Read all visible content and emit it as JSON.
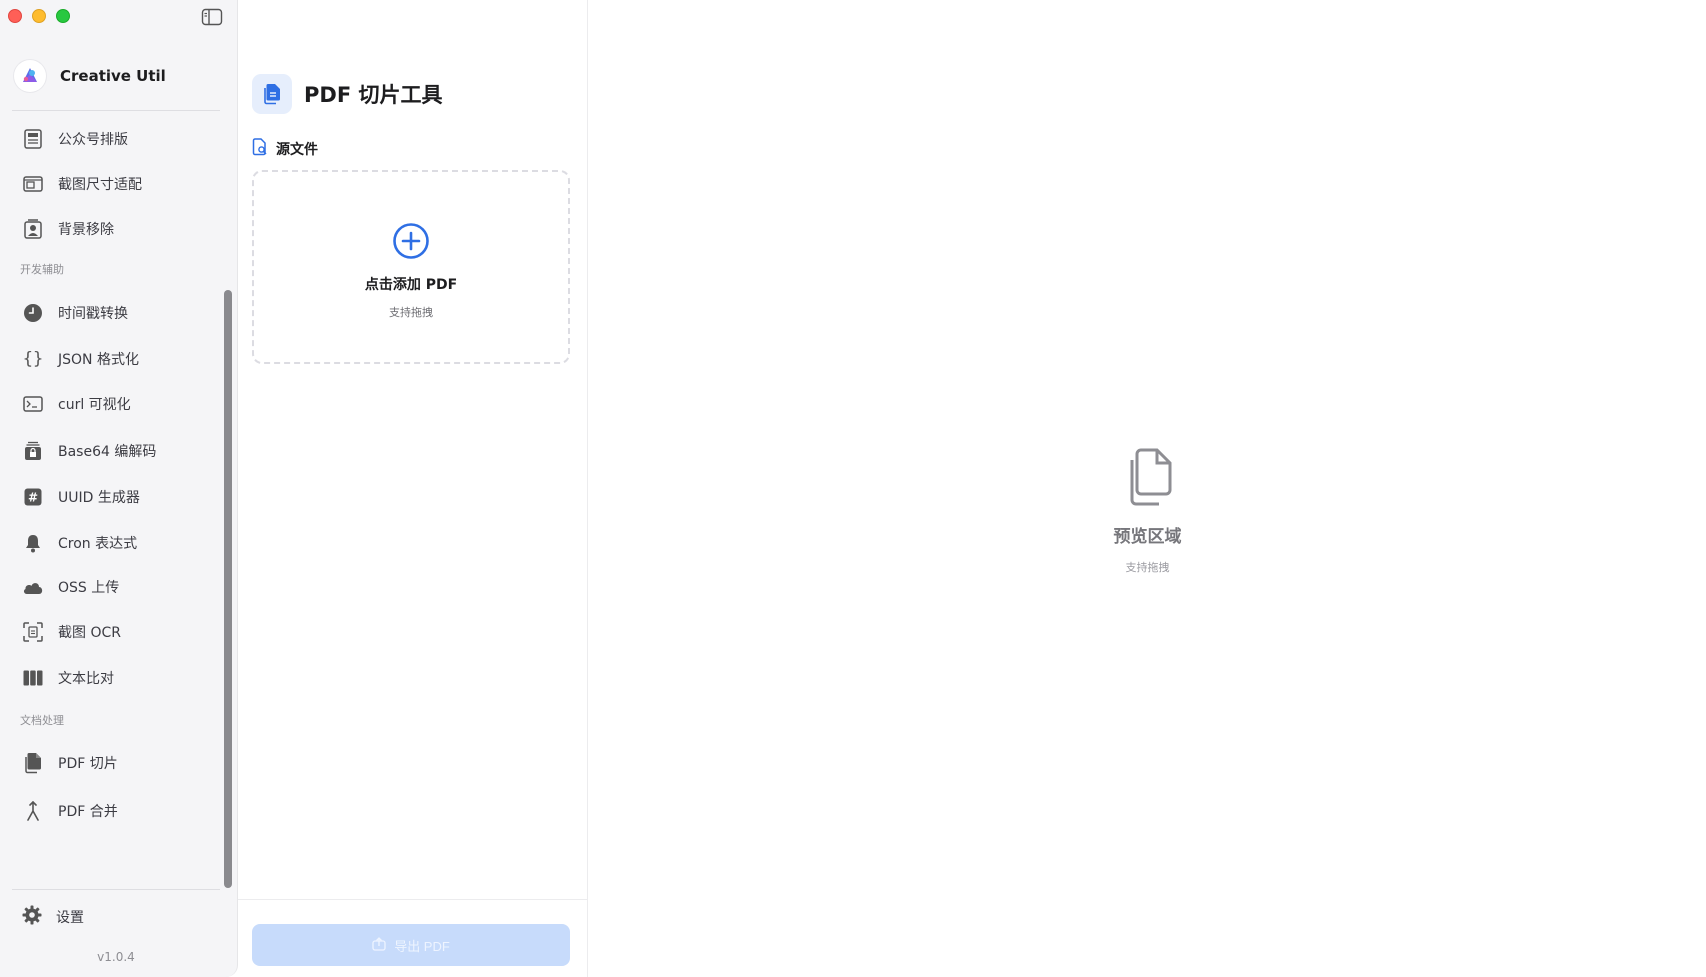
{
  "app": {
    "name": "Creative Util",
    "version": "v1.0.4"
  },
  "sidebar": {
    "items_top": [
      {
        "label": "公众号排版",
        "icon": "newspaper-icon"
      },
      {
        "label": "截图尺寸适配",
        "icon": "layout-icon"
      },
      {
        "label": "背景移除",
        "icon": "person-frame-icon"
      }
    ],
    "section_dev": "开发辅助",
    "items_dev": [
      {
        "label": "时间戳转换",
        "icon": "clock-icon"
      },
      {
        "label": "JSON 格式化",
        "icon": "braces-icon"
      },
      {
        "label": "curl 可视化",
        "icon": "terminal-icon"
      },
      {
        "label": "Base64 编解码",
        "icon": "lock-stack-icon"
      },
      {
        "label": "UUID 生成器",
        "icon": "hash-icon"
      },
      {
        "label": "Cron 表达式",
        "icon": "bell-icon"
      },
      {
        "label": "OSS 上传",
        "icon": "cloud-icon"
      },
      {
        "label": "截图 OCR",
        "icon": "ocr-scan-icon"
      },
      {
        "label": "文本比对",
        "icon": "columns-icon"
      }
    ],
    "section_doc": "文档处理",
    "items_doc": [
      {
        "label": "PDF 切片",
        "icon": "documents-icon"
      },
      {
        "label": "PDF 合并",
        "icon": "merge-icon"
      }
    ],
    "settings_label": "设置"
  },
  "panel": {
    "title": "PDF 切片工具",
    "source_label": "源文件",
    "dropzone_title": "点击添加 PDF",
    "dropzone_sub": "支持拖拽",
    "export_label": "导出 PDF"
  },
  "preview": {
    "title": "预览区域",
    "sub": "支持拖拽"
  },
  "colors": {
    "accent": "#2f6fe4",
    "export_disabled": "#c7dbfb",
    "sidebar_bg": "#f5f5f7"
  }
}
